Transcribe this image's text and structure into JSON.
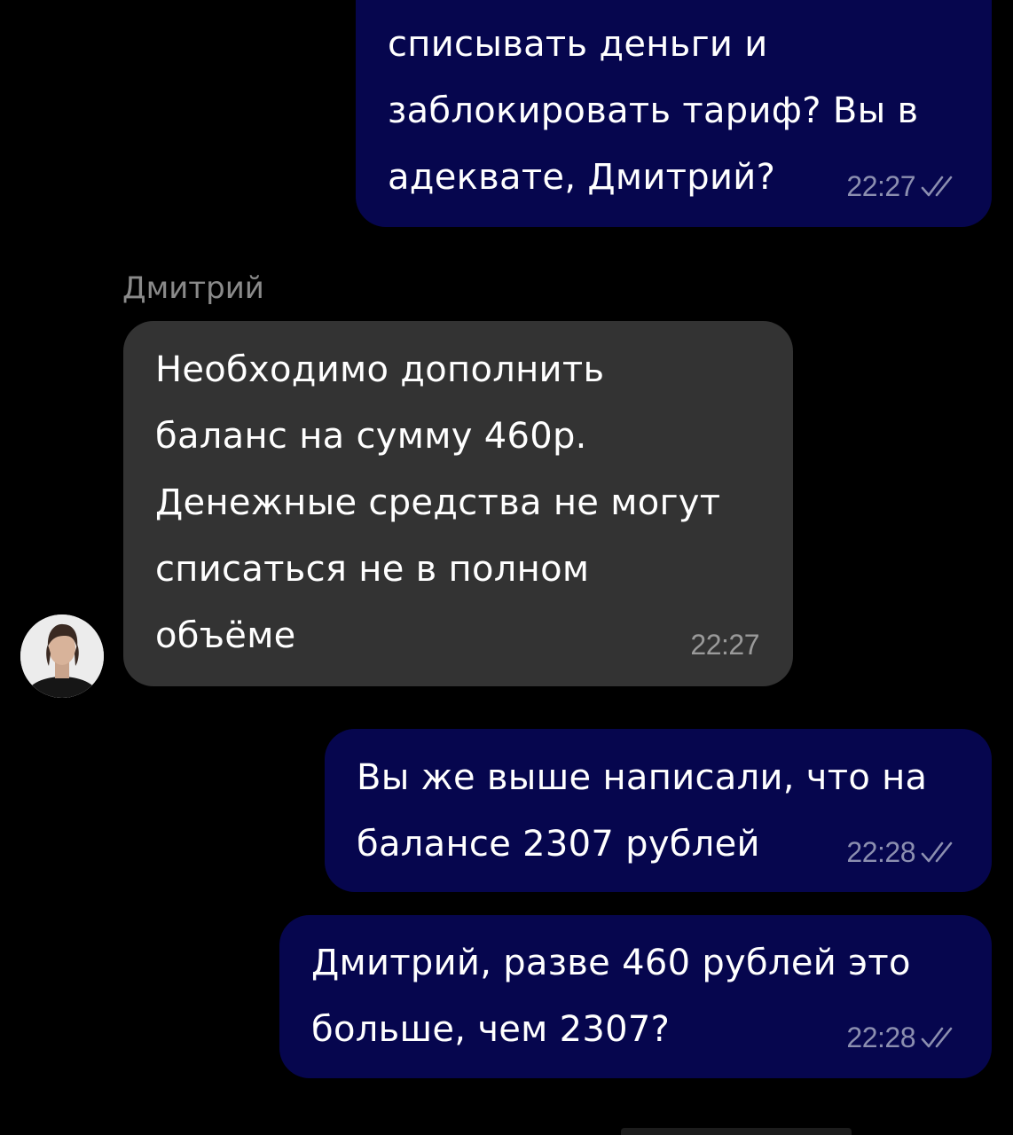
{
  "messages": [
    {
      "direction": "outgoing",
      "lines": [
        "списывать деньги и",
        "заблокировать тариф? Вы в",
        "адеквате, Дмитрий?"
      ],
      "time": "22:27",
      "status_icon": "double-check-icon"
    },
    {
      "direction": "incoming",
      "sender": "Дмитрий",
      "lines": [
        "Необходимо дополнить",
        "баланс на сумму 460р.",
        "Денежные средства не могут",
        "списаться не в полном",
        "объёме"
      ],
      "time": "22:27",
      "avatar_icon": "avatar-photo"
    },
    {
      "direction": "outgoing",
      "lines": [
        "Вы же выше написали, что на",
        "балансе 2307 рублей"
      ],
      "time": "22:28",
      "status_icon": "double-check-icon"
    },
    {
      "direction": "outgoing",
      "lines": [
        "Дмитрий, разве 460 рублей это",
        "больше, чем 2307?"
      ],
      "time": "22:28",
      "status_icon": "double-check-icon"
    }
  ],
  "colors": {
    "background": "#000000",
    "outgoing_bubble": "#06064e",
    "incoming_bubble": "#333333",
    "sender_name": "#8a8a8a",
    "outgoing_time": "#8c8fb0"
  }
}
